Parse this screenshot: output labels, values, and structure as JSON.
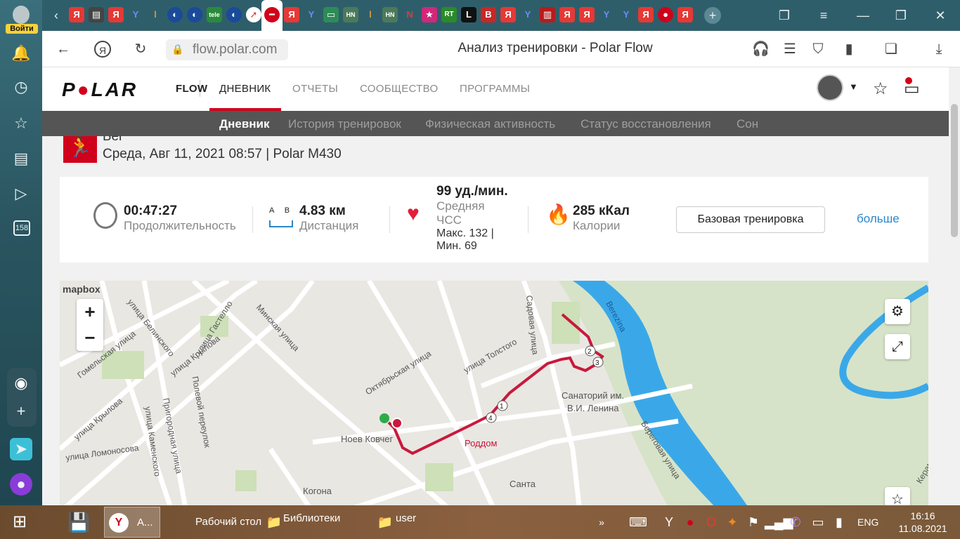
{
  "yandex_sidebar": {
    "login_label": "Войти",
    "downloads_badge": "158"
  },
  "browser": {
    "url": "flow.polar.com",
    "page_title": "Анализ тренировки - Polar Flow"
  },
  "polar": {
    "brand": "POLAR",
    "nav": {
      "flow": "FLOW",
      "diary": "ДНЕВНИК",
      "reports": "ОТЧЕТЫ",
      "community": "СООБЩЕСТВО",
      "programs": "ПРОГРАММЫ"
    },
    "subnav": {
      "diary": "Дневник",
      "history": "История тренировок",
      "activity": "Физическая активность",
      "recovery": "Статус восстановления",
      "sleep": "Сон"
    }
  },
  "workout": {
    "sport": "Бег",
    "date": "Среда, Авг 11, 2021 08:57 | Polar M430",
    "duration": {
      "value": "00:47:27",
      "label": "Продолжительность"
    },
    "distance": {
      "value": "4.83 км",
      "label": "Дистанция",
      "icon_letters": "A B"
    },
    "heart_rate": {
      "value": "99 уд./мин.",
      "label1": "Средняя",
      "label2": "ЧСС",
      "max": "Макс. 132 |",
      "min": "Мин. 69"
    },
    "calories": {
      "value": "285 кКал",
      "label": "Калории"
    },
    "basic_training_button": "Базовая тренировка",
    "more_link": "больше"
  },
  "map": {
    "attribution": "mapbox",
    "zoom_in": "+",
    "zoom_out": "−",
    "labels": {
      "gastello": "улица Гастелло",
      "belinsky": "улица Белинского",
      "gomelskaya": "Гомельская улица",
      "minskaya": "Минская улица",
      "krylova1": "улица Крылова",
      "krylova2": "улица Крылова",
      "polevoy": "Полевой переулок",
      "prigorodnaya": "Пригородная улица",
      "kamenskogo": "улица Каменского",
      "lomonosova": "улица Ломоносова",
      "oktyabrskaya": "Октябрьская улица",
      "tolstogo": "улица Толстого",
      "sadovaya": "Садовая улица",
      "noev": "Ноев Ковчег",
      "roddom": "Роддом",
      "sanatoriy1": "Санаторий им.",
      "sanatoriy2": "В.И. Ленина",
      "beregovaya": "Береговая улица",
      "berezina": "Berezina",
      "kogona": "Когона",
      "santa": "Санта",
      "keramich": "Керамич"
    },
    "lap_markers": [
      "1",
      "2",
      "3",
      "4"
    ]
  },
  "taskbar": {
    "yandex_task": "А...",
    "desktop": "Рабочий стол",
    "libraries": "Библиотеки",
    "user": "user",
    "lang": "ENG",
    "time": "16:16",
    "date": "11.08.2021"
  },
  "colors": {
    "accent": "#d0021b",
    "route": "#c8193c",
    "water": "#3aa8e8"
  }
}
